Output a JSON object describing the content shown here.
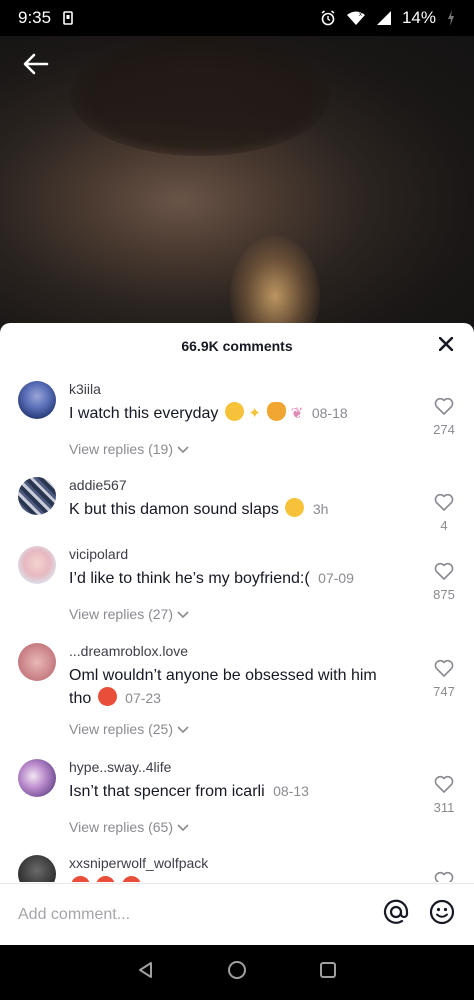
{
  "status_bar": {
    "time": "9:35",
    "battery": "14%",
    "icons": [
      "sim-icon",
      "alarm-icon",
      "wifi-icon",
      "signal-icon",
      "battery-icon"
    ]
  },
  "video": {
    "back_icon": "arrow-left-icon"
  },
  "comments_sheet": {
    "title": "66.9K comments",
    "close_icon": "close-icon",
    "comments": [
      {
        "username": "k3iila",
        "text": "I watch this everyday",
        "emojis": [
          "pensive-emoji",
          "sparkles-emoji",
          "cat-emoji",
          "fairy-emoji"
        ],
        "date": "08-18",
        "likes": "274",
        "replies": "View replies (19)"
      },
      {
        "username": "addie567",
        "text": "K but this damon sound slaps",
        "emojis": [
          "flushed-emoji"
        ],
        "date": "3h",
        "likes": "4",
        "replies": ""
      },
      {
        "username": "vicipolard",
        "text": "I’d like to think he’s my boyfriend:(",
        "emojis": [],
        "date": "07-09",
        "likes": "875",
        "replies": "View replies (27)"
      },
      {
        "username": "...dreamroblox.love",
        "text_line1": "Oml wouldn’t anyone be obsessed with him",
        "text_line2": "tho",
        "emojis": [
          "heart-eyes-emoji"
        ],
        "date": "07-23",
        "likes": "747",
        "replies": "View replies (25)"
      },
      {
        "username": "hype..sway..4life",
        "text": "Isn’t that spencer from icarli",
        "emojis": [],
        "date": "08-13",
        "likes": "311",
        "replies": "View replies (65)"
      },
      {
        "username": "xxsniperwolf_wolfpack",
        "text": "",
        "emojis": [
          "partial-emoji"
        ],
        "date": "",
        "likes": "",
        "replies": ""
      }
    ]
  },
  "input_bar": {
    "placeholder": "Add comment...",
    "mention_icon": "at-icon",
    "emoji_icon": "smiley-icon"
  },
  "nav_bar": {
    "icons": [
      "back-triangle-icon",
      "home-circle-icon",
      "recents-square-icon"
    ]
  },
  "colors": {
    "text_primary": "#161823",
    "text_secondary": "#8a8b91",
    "sheet_bg": "#ffffff"
  }
}
